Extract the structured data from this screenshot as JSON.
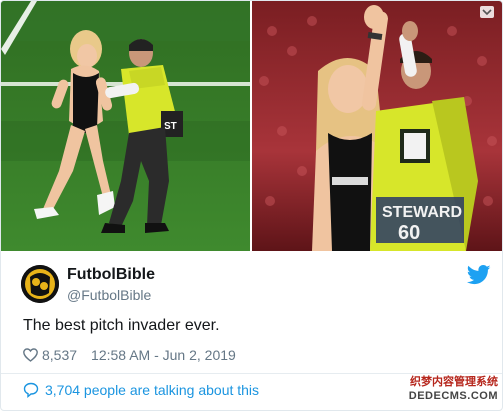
{
  "tweet": {
    "author_name": "FutbolBible",
    "author_handle": "@FutbolBible",
    "text": "The best pitch invader ever.",
    "likes": "8,537",
    "timestamp": "12:58 AM - Jun 2, 2019",
    "talking": "3,704 people are talking about this"
  },
  "photos": {
    "left": {
      "vest_text": "ST"
    },
    "right": {
      "vest_text": "STEWARD",
      "vest_number": "60"
    }
  },
  "watermark": {
    "line1": "织梦内容管理系统",
    "line2": "DEDECMS.COM"
  },
  "icons": {
    "bird": "twitter-bird-icon",
    "heart": "heart-icon",
    "reply": "speech-bubble-icon",
    "caret": "chevron-down-icon"
  },
  "colors": {
    "twitter_blue": "#1da1f2",
    "link_blue": "#1b95e0",
    "muted": "#657786",
    "text": "#14171a",
    "vest_yellow": "#d7e62a",
    "pitch_green": "#3a7f2a"
  }
}
